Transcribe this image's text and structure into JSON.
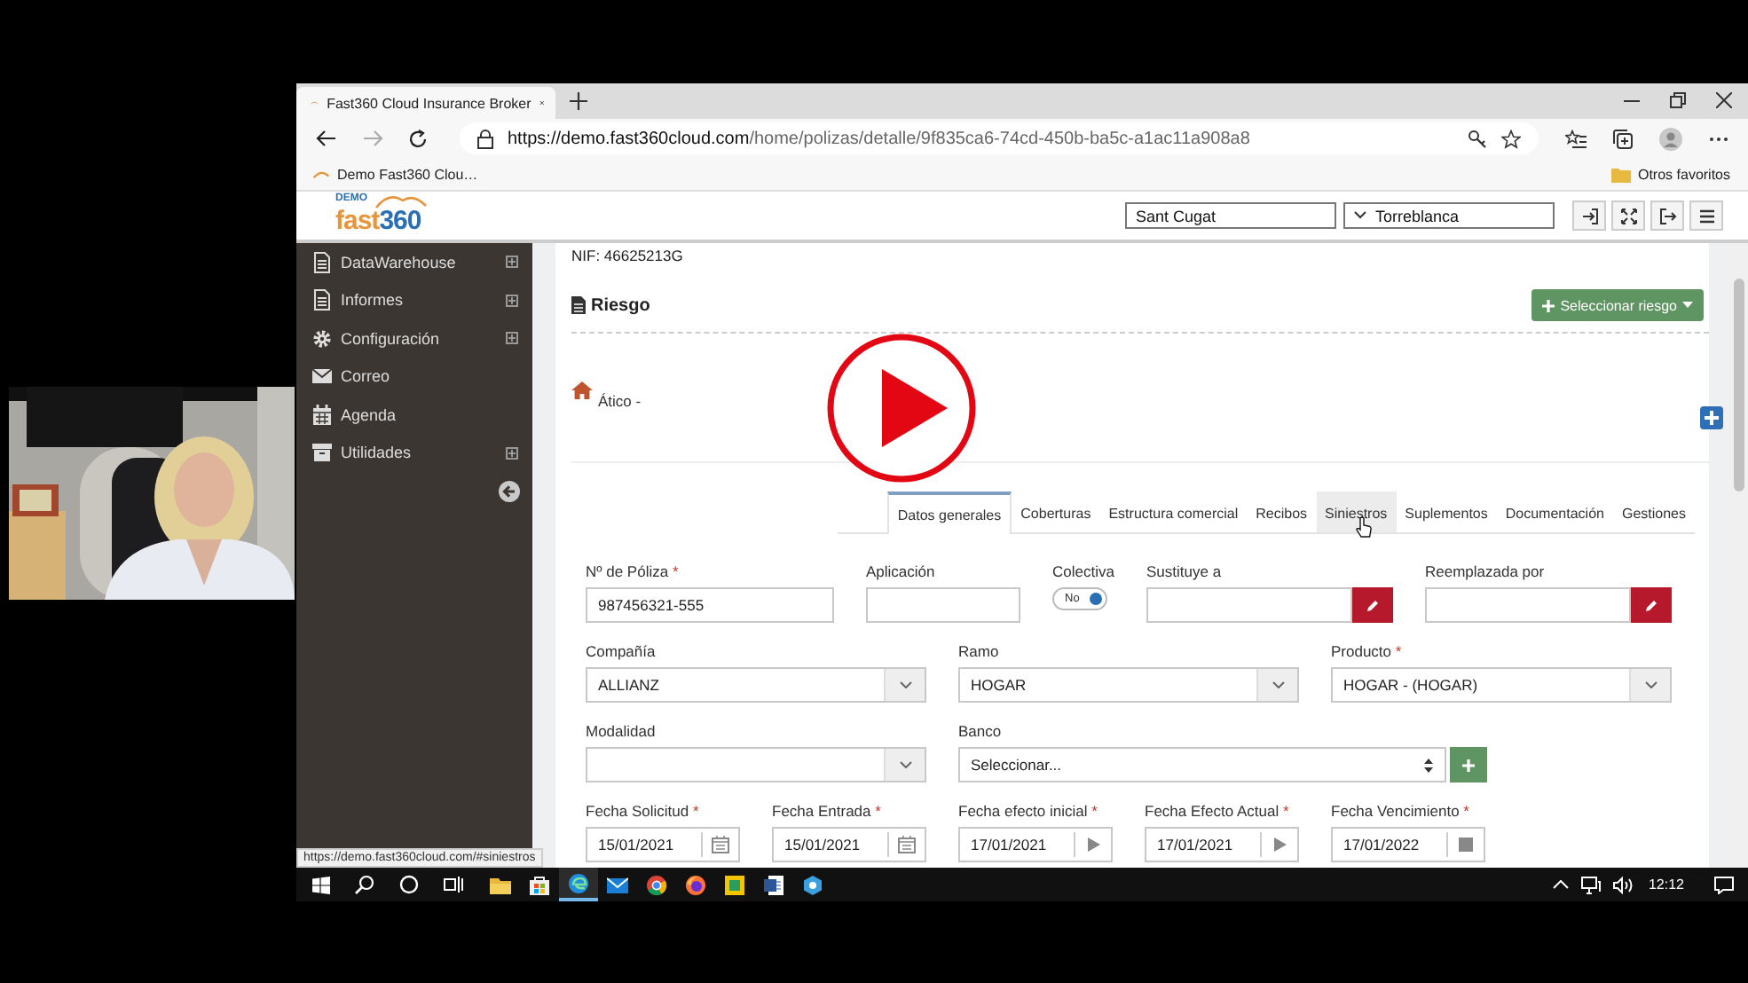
{
  "browser": {
    "tab_title": "Fast360 Cloud Insurance Broker",
    "url_host": "https://demo.fast360cloud.com",
    "url_path": "/home/polizas/detalle/9f835ca6-74cd-450b-ba5c-a1ac11a908a8",
    "bookmark": "Demo Fast360 Clou…",
    "other_favorites": "Otros favoritos",
    "status_url": "https://demo.fast360cloud.com/#siniestros"
  },
  "header": {
    "logo_tag": "DEMO",
    "logo_name_a": "fast",
    "logo_name_b": "360",
    "location": "Sant Cugat",
    "office": "Torreblanca"
  },
  "sidebar": {
    "items": [
      {
        "label": "DataWarehouse",
        "kind": "document",
        "expandable": true
      },
      {
        "label": "Informes",
        "kind": "document",
        "expandable": true
      },
      {
        "label": "Configuración",
        "kind": "gear",
        "expandable": true
      },
      {
        "label": "Correo",
        "kind": "envelope",
        "expandable": false
      },
      {
        "label": "Agenda",
        "kind": "calendar",
        "expandable": false
      },
      {
        "label": "Utilidades",
        "kind": "archive",
        "expandable": true
      }
    ]
  },
  "content": {
    "nif": "NIF: 46625213G",
    "section_title": "Riesgo",
    "select_button": "Seleccionar riesgo",
    "risk": "Ático -",
    "tabs": [
      {
        "label": "Datos generales",
        "selected": true,
        "hovered": false
      },
      {
        "label": "Coberturas",
        "selected": false,
        "hovered": false
      },
      {
        "label": "Estructura comercial",
        "selected": false,
        "hovered": false
      },
      {
        "label": "Recibos",
        "selected": false,
        "hovered": false
      },
      {
        "label": "Siniestros",
        "selected": false,
        "hovered": true
      },
      {
        "label": "Suplementos",
        "selected": false,
        "hovered": false
      },
      {
        "label": "Documentación",
        "selected": false,
        "hovered": false
      },
      {
        "label": "Gestiones",
        "selected": false,
        "hovered": false
      }
    ],
    "form_rows": [
      [
        {
          "kind": "text",
          "label": "Nº de Póliza",
          "required": "*",
          "value": "987456321-555"
        },
        {
          "kind": "text",
          "label": "Aplicación"
        },
        {
          "kind": "toggle",
          "label": "Colectiva",
          "value": "No",
          "on": true
        },
        {
          "kind": "lookup",
          "label": "Sustituye a"
        },
        {
          "kind": "lookup",
          "label": "Reemplazada por"
        }
      ],
      [
        {
          "kind": "select",
          "label": "Compañía",
          "value": "ALLIANZ"
        },
        {
          "kind": "select",
          "label": "Ramo",
          "value": "HOGAR"
        },
        {
          "kind": "select",
          "label": "Producto",
          "required": "*",
          "value": "HOGAR - (HOGAR)"
        }
      ],
      [
        {
          "kind": "select",
          "label": "Modalidad"
        },
        {
          "kind": "combo",
          "label": "Banco",
          "value": "Seleccionar..."
        }
      ],
      [
        {
          "kind": "datepicker",
          "label": "Fecha Solicitud",
          "required": "*",
          "value": "15/01/2021"
        },
        {
          "kind": "datepicker",
          "label": "Fecha Entrada",
          "required": "*",
          "value": "15/01/2021"
        },
        {
          "kind": "datestep",
          "label": "Fecha efecto inicial",
          "required": "*",
          "value": "17/01/2021"
        },
        {
          "kind": "datestep",
          "label": "Fecha Efecto Actual",
          "required": "*",
          "value": "17/01/2021"
        },
        {
          "kind": "datestop",
          "label": "Fecha Vencimiento",
          "required": "*",
          "value": "17/01/2022"
        }
      ]
    ]
  },
  "taskbar": {
    "apps": [
      {
        "kind": "explorer",
        "active": false
      },
      {
        "kind": "store",
        "active": false
      },
      {
        "kind": "edge",
        "active": true
      },
      {
        "kind": "mail",
        "active": false
      },
      {
        "kind": "chrome",
        "active": false
      },
      {
        "kind": "firefox",
        "active": false
      },
      {
        "kind": "tile",
        "active": false
      },
      {
        "kind": "word",
        "active": false
      },
      {
        "kind": "hexagon",
        "active": false
      }
    ],
    "time": "12:12"
  }
}
